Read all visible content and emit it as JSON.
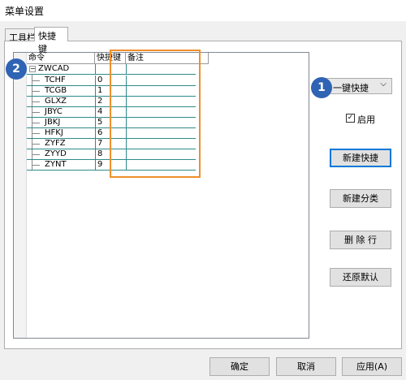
{
  "window": {
    "title": "菜单设置"
  },
  "tabs": [
    {
      "label": "工具栏",
      "active": false
    },
    {
      "label": "快捷键",
      "active": true
    }
  ],
  "tree": {
    "columns": {
      "command": "命令",
      "shortcut": "快捷键",
      "note": "备注"
    },
    "root": {
      "label": "ZWCAD",
      "expander": "−"
    },
    "rows": [
      {
        "command": "TCHF",
        "shortcut": "0",
        "note": ""
      },
      {
        "command": "TCGB",
        "shortcut": "1",
        "note": ""
      },
      {
        "command": "GLXZ",
        "shortcut": "2",
        "note": ""
      },
      {
        "command": "JBYC",
        "shortcut": "4",
        "note": ""
      },
      {
        "command": "JBKJ",
        "shortcut": "5",
        "note": ""
      },
      {
        "command": "HFKJ",
        "shortcut": "6",
        "note": ""
      },
      {
        "command": "ZYFZ",
        "shortcut": "7",
        "note": ""
      },
      {
        "command": "ZYYD",
        "shortcut": "8",
        "note": ""
      },
      {
        "command": "ZYNT",
        "shortcut": "9",
        "note": ""
      }
    ]
  },
  "badges": {
    "one": "1",
    "two": "2"
  },
  "side": {
    "combo_value": "一键快捷",
    "combo_arrow": "⌵",
    "enable_label": "启用",
    "enable_checked": "✓",
    "new_shortcut": "新建快捷",
    "new_category": "新建分类",
    "delete_row": "删 除 行",
    "restore_default": "还原默认"
  },
  "footer": {
    "ok": "确定",
    "cancel": "取消",
    "apply": "应用(A)"
  },
  "colors": {
    "highlight": "#f0902a",
    "badge": "#2f63b4",
    "grid": "#2e8b8b"
  }
}
